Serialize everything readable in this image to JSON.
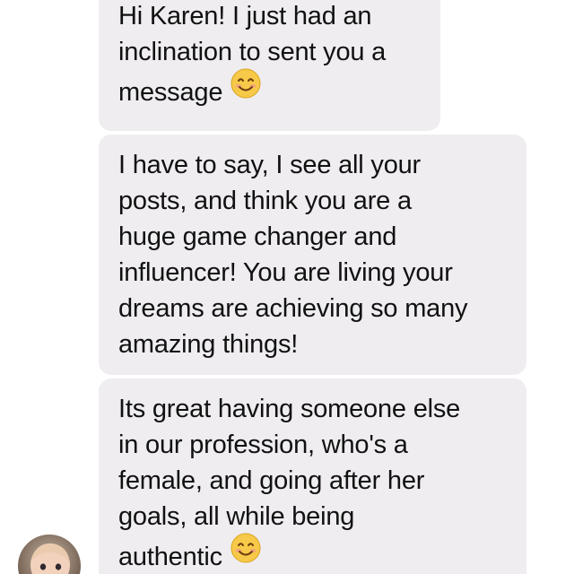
{
  "messages": [
    {
      "lines": [
        "Hi Karen!  I just had an",
        "inclination to sent you a",
        "message"
      ],
      "emoji": "smiling-face-emoji"
    },
    {
      "lines": [
        "I have to say, I see all your",
        "posts, and think you are a",
        "huge game changer and",
        "influencer!  You are living your",
        "dreams are achieving so many",
        "amazing things!"
      ]
    },
    {
      "lines": [
        "Its great having someone else",
        "in our profession, who's a",
        "female, and going after her",
        "goals, all while being",
        "authentic"
      ],
      "emoji": "smiling-face-emoji"
    }
  ],
  "sender": {
    "avatar": "baby-photo-avatar"
  },
  "colors": {
    "bubble": "#efedf0",
    "text": "#111111",
    "emoji_face": "#f7c948"
  }
}
